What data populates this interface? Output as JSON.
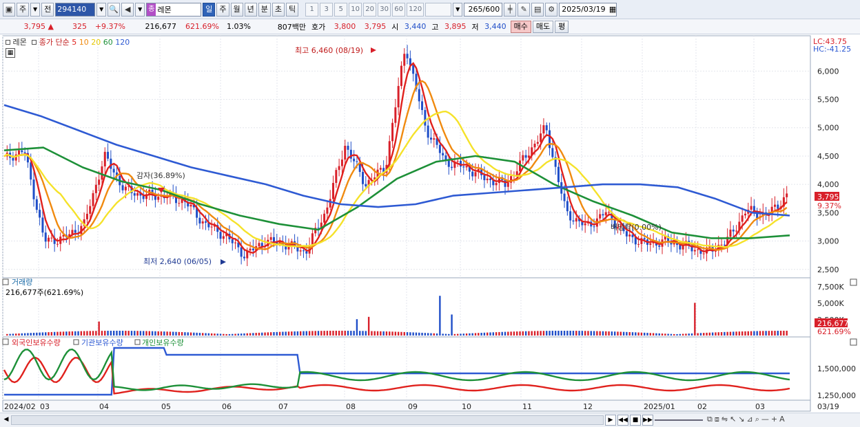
{
  "toolbar": {
    "market": "주",
    "prev_label": "전",
    "stock_code": "294140",
    "name_tag": "종",
    "stock_name": "레몬",
    "periods": [
      "일",
      "주",
      "월",
      "년",
      "분",
      "초",
      "틱"
    ],
    "active_period": "일",
    "intervals": [
      "1",
      "3",
      "5",
      "10",
      "20",
      "30",
      "60",
      "120"
    ],
    "count": "265",
    "count_total": "/600",
    "date": "2025/03/19"
  },
  "quote": {
    "price": "3,795",
    "change": "325",
    "change_pct": "+9.37%",
    "volume": "216,677",
    "volume_ratio": "621.69%",
    "turnover": "1.03%",
    "amount": "807백만",
    "ask_label": "호가",
    "ask": "3,800",
    "bid": "3,795",
    "open_label": "시",
    "open": "3,440",
    "high_label": "고",
    "high": "3,895",
    "low_label": "저",
    "low": "3,440",
    "buy_label": "매수",
    "sell_label": "매도",
    "avg_label": "평"
  },
  "legend": {
    "name": "레몬",
    "ma_label": "종가 단순",
    "ma_periods": [
      "5",
      "10",
      "20",
      "60",
      "120"
    ],
    "ma_colors": [
      "#e0211d",
      "#f08a0f",
      "#f5e22a",
      "#1d9038",
      "#2e5ad3"
    ],
    "lc": "LC:43.75",
    "hc": "HC:-41.25"
  },
  "annotations": {
    "high": "최고 6,460 (08/19)",
    "low": "최저 2,640 (06/05)",
    "capital_reduction": "감자(36.89%)",
    "dividend": "배당락(0.00%)"
  },
  "volume_panel": {
    "title": "거래량",
    "info": "216,677주(621.69%)",
    "axis": [
      "7,500K",
      "5,000K",
      "2,500K"
    ],
    "last": "216,677",
    "last_pct": "621.69%"
  },
  "holdings_panel": {
    "series": [
      "외국인보유수량",
      "기관보유수량",
      "개인보유수량"
    ],
    "colors": [
      "#e0211d",
      "#2e5ad3",
      "#1d9038"
    ],
    "axis": [
      "1,500,000",
      "1,250,000"
    ]
  },
  "x_axis": [
    "2024/02",
    "03",
    "04",
    "05",
    "06",
    "07",
    "08",
    "09",
    "10",
    "11",
    "12",
    "2025/01",
    "02",
    "03",
    "03/19"
  ],
  "chart_data": {
    "type": "candlestick",
    "y_axis_ticks": [
      6000,
      5500,
      5000,
      4500,
      4000,
      3500,
      3000,
      2500
    ],
    "ylim": [
      2400,
      6550
    ],
    "last_price": 3795,
    "last_change_pct": "9.37%",
    "close_points": [
      {
        "t": "2024/02",
        "v": 4450
      },
      {
        "t": "02 mid",
        "v": 4600
      },
      {
        "t": "02 end",
        "v": 3000
      },
      {
        "t": "03",
        "v": 3050
      },
      {
        "t": "03 mid",
        "v": 3300
      },
      {
        "t": "03 late",
        "v": 4500
      },
      {
        "t": "04",
        "v": 3900
      },
      {
        "t": "04 mid",
        "v": 3800
      },
      {
        "t": "04 late",
        "v": 3800
      },
      {
        "t": "05",
        "v": 3700
      },
      {
        "t": "05 mid",
        "v": 3300
      },
      {
        "t": "05 late",
        "v": 3100
      },
      {
        "t": "06",
        "v": 2750
      },
      {
        "t": "06 mid",
        "v": 3000
      },
      {
        "t": "06 late",
        "v": 2950
      },
      {
        "t": "07",
        "v": 2800
      },
      {
        "t": "07 mid",
        "v": 3500
      },
      {
        "t": "07 late",
        "v": 4700
      },
      {
        "t": "08",
        "v": 4000
      },
      {
        "t": "08 mid",
        "v": 4300
      },
      {
        "t": "08/19",
        "v": 6460
      },
      {
        "t": "08 late",
        "v": 5000
      },
      {
        "t": "09",
        "v": 4400
      },
      {
        "t": "09 mid",
        "v": 4300
      },
      {
        "t": "10",
        "v": 4100
      },
      {
        "t": "10 mid",
        "v": 4000
      },
      {
        "t": "10 late",
        "v": 4500
      },
      {
        "t": "11",
        "v": 5000
      },
      {
        "t": "11 mid",
        "v": 3500
      },
      {
        "t": "11 late",
        "v": 3250
      },
      {
        "t": "12",
        "v": 3500
      },
      {
        "t": "12 mid",
        "v": 3100
      },
      {
        "t": "12 late",
        "v": 2950
      },
      {
        "t": "2025/01",
        "v": 3000
      },
      {
        "t": "01 mid",
        "v": 2900
      },
      {
        "t": "02",
        "v": 2800
      },
      {
        "t": "02 mid",
        "v": 3000
      },
      {
        "t": "03",
        "v": 3550
      },
      {
        "t": "03 mid",
        "v": 3450
      },
      {
        "t": "03/19",
        "v": 3795
      }
    ],
    "ma120_points": [
      5400,
      5200,
      4950,
      4700,
      4500,
      4300,
      4150,
      4000,
      3800,
      3650,
      3600,
      3650,
      3800,
      3850,
      3900,
      3950,
      4000,
      4000,
      3950,
      3750,
      3500,
      3450
    ],
    "ma60_points": [
      4600,
      4650,
      4300,
      4050,
      3900,
      3650,
      3450,
      3300,
      3200,
      3600,
      4100,
      4400,
      4500,
      4400,
      4000,
      3700,
      3450,
      3150,
      3050,
      3050,
      3100
    ],
    "ma20_points": [
      4300,
      3500,
      4000,
      3750,
      3250,
      2950,
      2900,
      3600,
      4200,
      4900,
      4700,
      4350,
      4300,
      4500,
      3600,
      3450,
      3050,
      2950,
      2900,
      3000,
      3300,
      3500
    ]
  }
}
